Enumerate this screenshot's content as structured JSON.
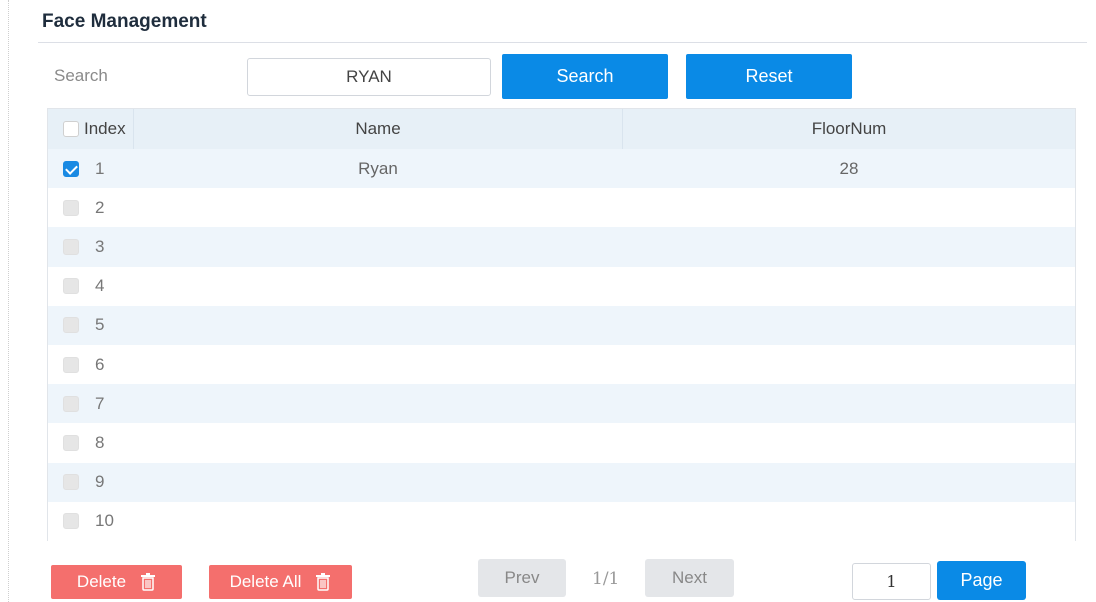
{
  "page": {
    "title": "Face Management"
  },
  "search": {
    "label": "Search",
    "value": "RYAN",
    "search_button": "Search",
    "reset_button": "Reset"
  },
  "table": {
    "columns": {
      "index": "Index",
      "name": "Name",
      "floor": "FloorNum"
    },
    "rows": [
      {
        "index": "1",
        "name": "Ryan",
        "floor": "28",
        "checked": true
      },
      {
        "index": "2",
        "name": "",
        "floor": "",
        "checked": false
      },
      {
        "index": "3",
        "name": "",
        "floor": "",
        "checked": false
      },
      {
        "index": "4",
        "name": "",
        "floor": "",
        "checked": false
      },
      {
        "index": "5",
        "name": "",
        "floor": "",
        "checked": false
      },
      {
        "index": "6",
        "name": "",
        "floor": "",
        "checked": false
      },
      {
        "index": "7",
        "name": "",
        "floor": "",
        "checked": false
      },
      {
        "index": "8",
        "name": "",
        "floor": "",
        "checked": false
      },
      {
        "index": "9",
        "name": "",
        "floor": "",
        "checked": false
      },
      {
        "index": "10",
        "name": "",
        "floor": "",
        "checked": false
      }
    ]
  },
  "actions": {
    "delete": "Delete",
    "delete_all": "Delete All"
  },
  "pagination": {
    "prev": "Prev",
    "indicator": "1/1",
    "next": "Next",
    "page_value": "1",
    "page_button": "Page"
  },
  "colors": {
    "primary": "#0a8ae6",
    "danger": "#f46f6d",
    "header_bg": "#e7f0f7",
    "stripe_bg": "#eef5fb"
  }
}
